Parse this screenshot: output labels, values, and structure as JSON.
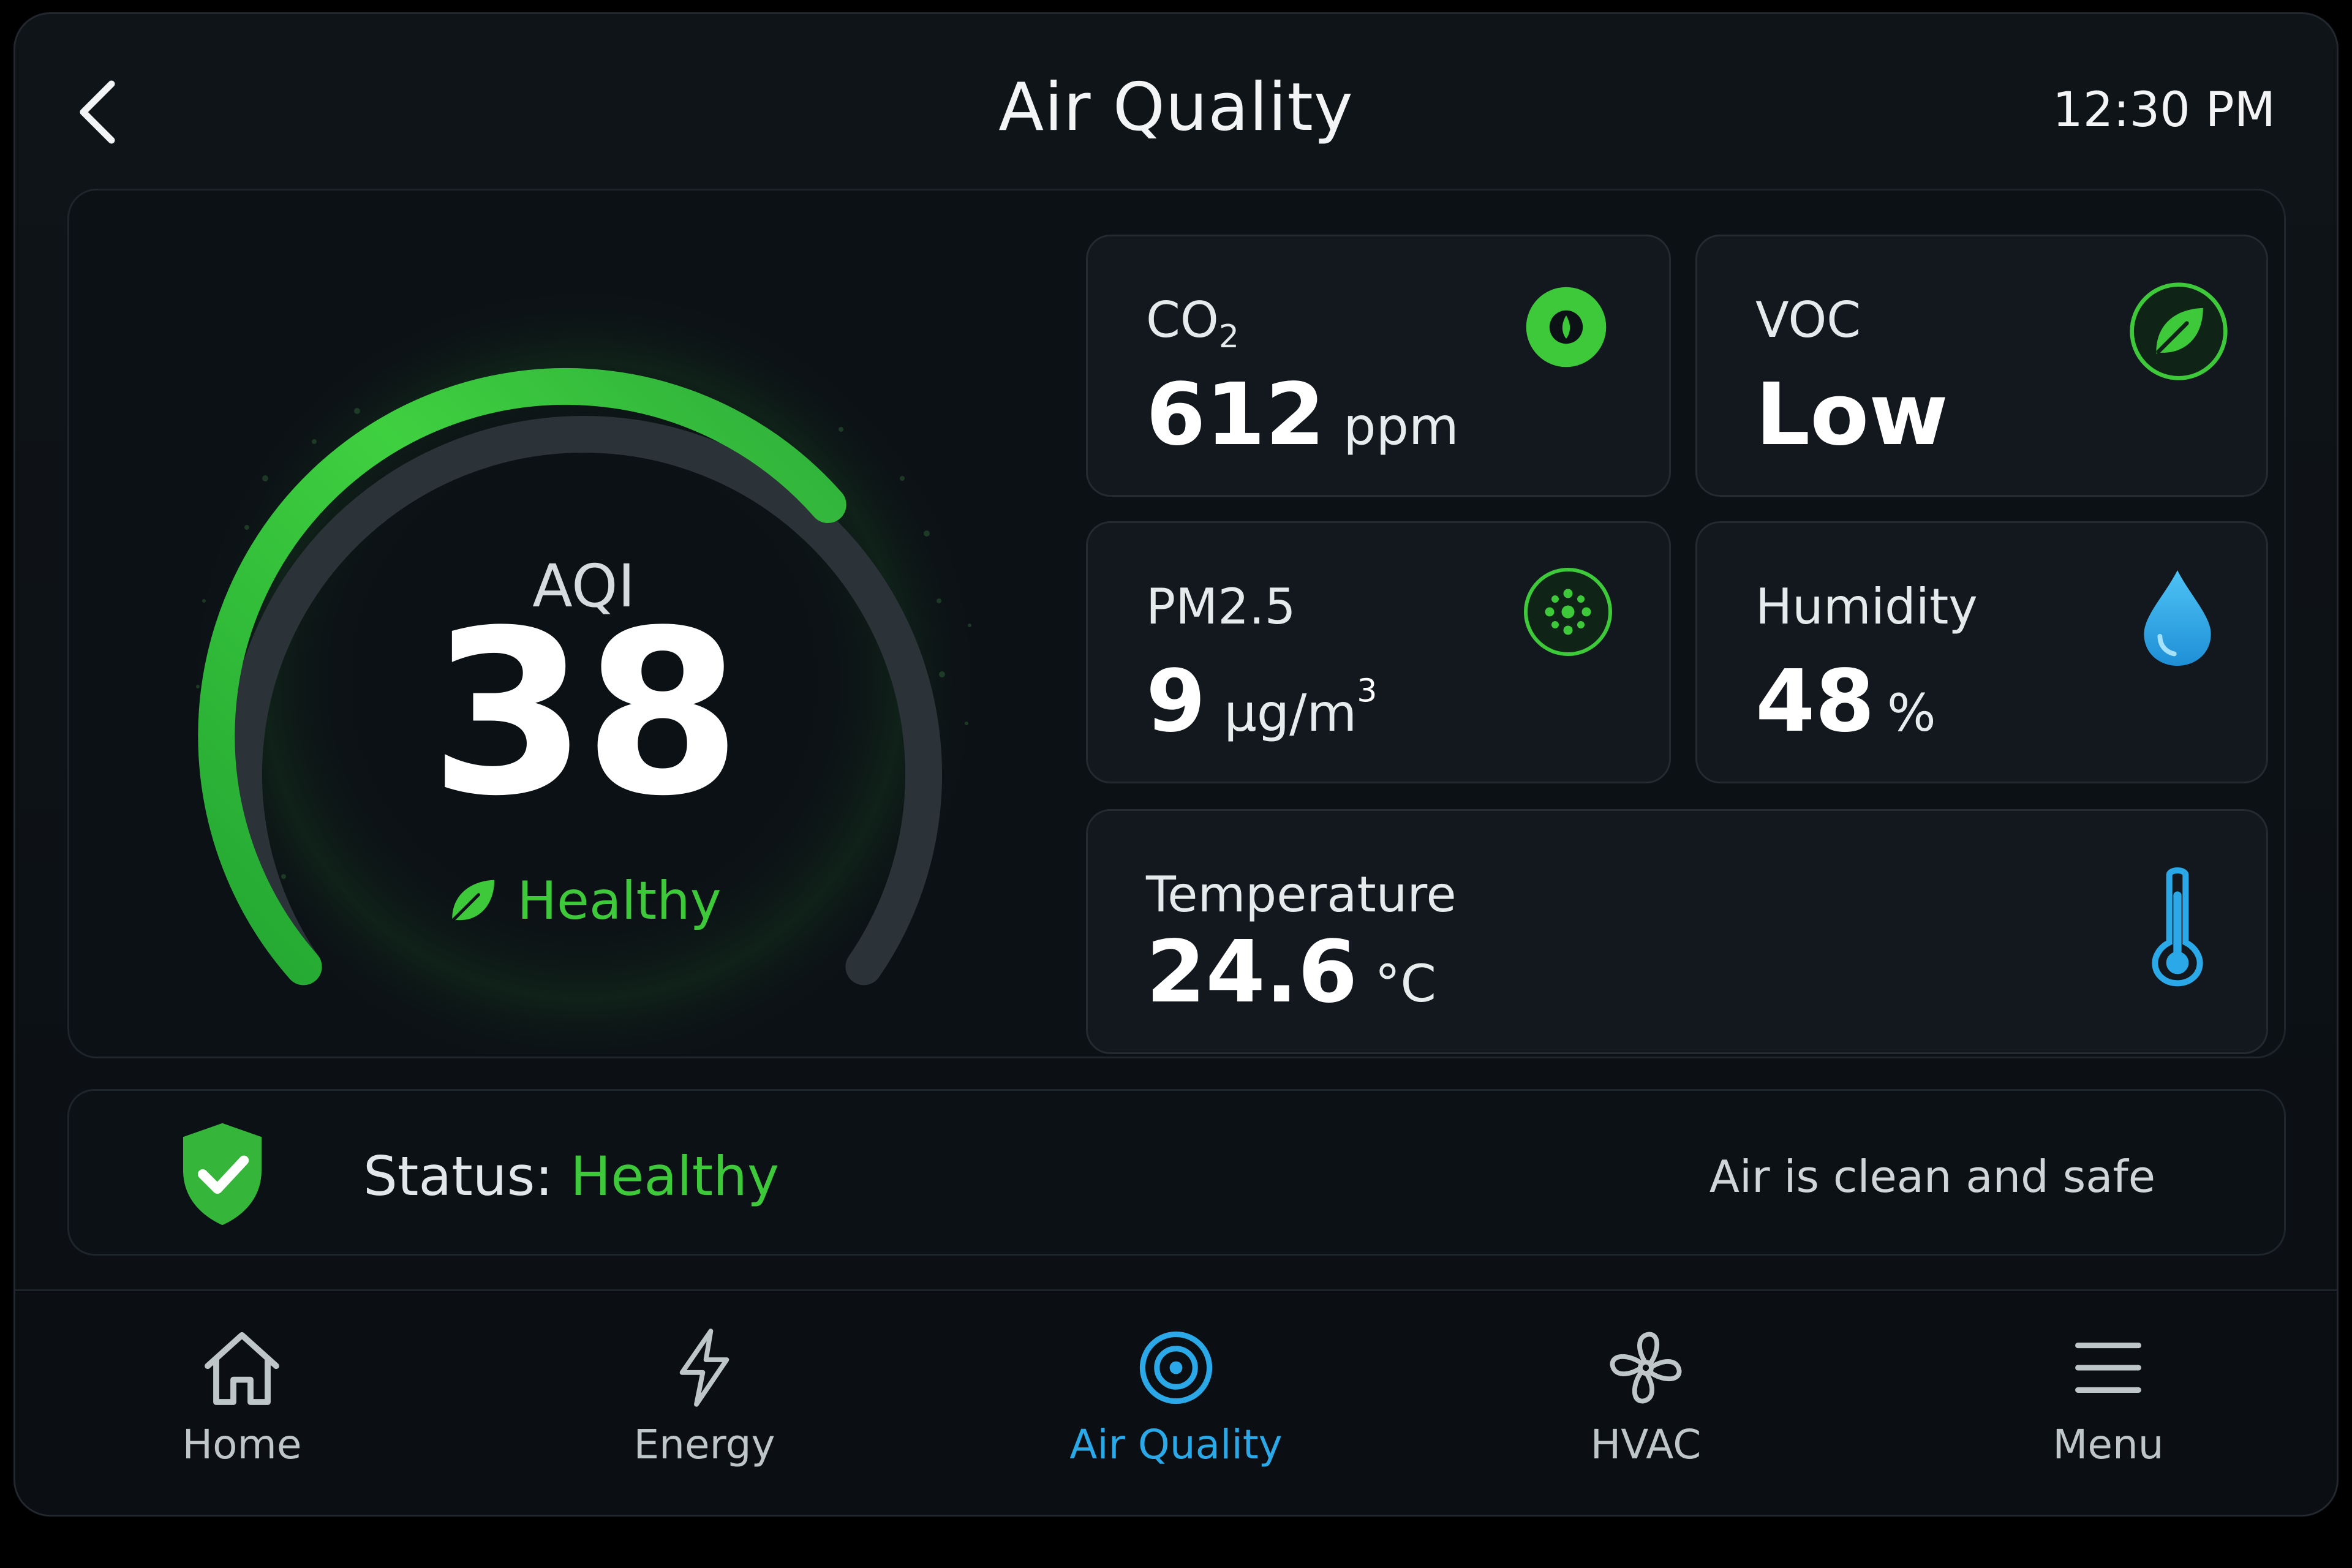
{
  "header": {
    "title": "Air Quality",
    "time": "12:30 PM",
    "back_icon": "chevron-left-icon"
  },
  "aqi": {
    "label": "AQI",
    "value": "38",
    "status": "Healthy",
    "status_icon": "leaf-icon",
    "color": "#3ec93b"
  },
  "metrics": {
    "co2": {
      "label_main": "CO",
      "label_sub": "2",
      "value": "612",
      "unit": "ppm",
      "icon": "co2-icon"
    },
    "voc": {
      "label": "VOC",
      "value": "Low",
      "icon": "leaf-icon"
    },
    "pm25": {
      "label": "PM2.5",
      "value": "9",
      "unit": "µg/m",
      "unit_sup": "3",
      "icon": "particles-icon"
    },
    "humidity": {
      "label": "Humidity",
      "value": "48",
      "unit": "%",
      "icon": "water-drop-icon"
    },
    "temperature": {
      "label": "Temperature",
      "value": "24.6",
      "unit": "°C",
      "icon": "thermometer-icon"
    }
  },
  "status": {
    "label": "Status:",
    "value": "Healthy",
    "description": "Air is clean and safe",
    "icon": "shield-check-icon"
  },
  "nav": {
    "items": [
      {
        "label": "Home",
        "icon": "home-icon"
      },
      {
        "label": "Energy",
        "icon": "lightning-icon"
      },
      {
        "label": "Air Quality",
        "icon": "target-icon",
        "active": true
      },
      {
        "label": "HVAC",
        "icon": "fan-icon"
      },
      {
        "label": "Menu",
        "icon": "hamburger-icon"
      }
    ]
  },
  "colors": {
    "accent_green": "#3ec93b",
    "accent_blue": "#2aa8e8",
    "background": "#0b0f13"
  }
}
